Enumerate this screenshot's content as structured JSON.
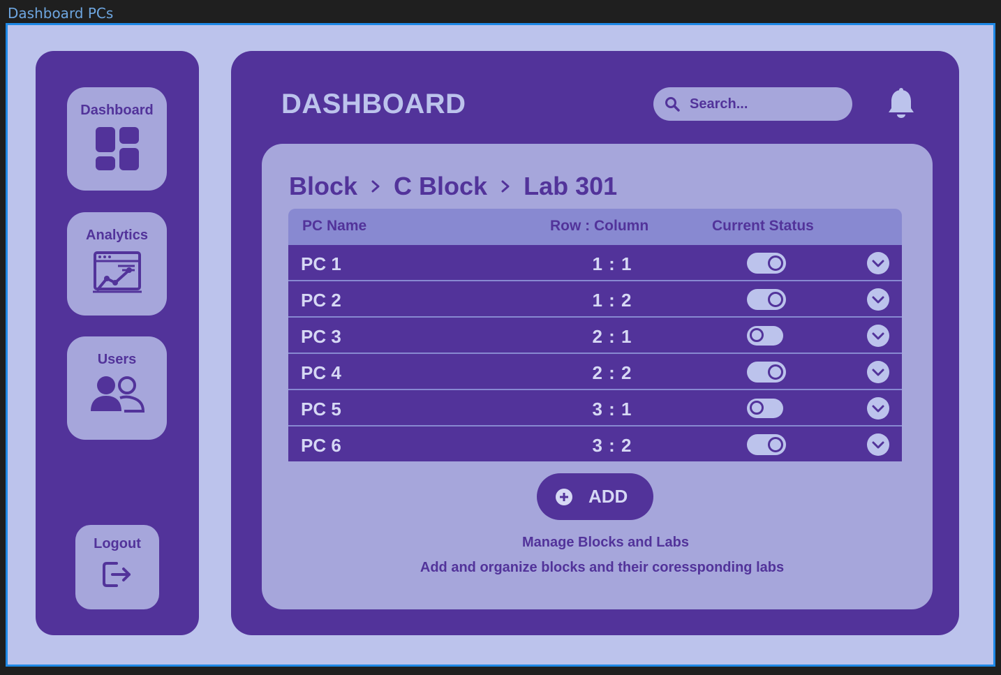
{
  "frame_title": "Dashboard PCs",
  "sidebar": {
    "items": [
      {
        "label": "Dashboard",
        "icon": "grid-icon"
      },
      {
        "label": "Analytics",
        "icon": "analytics-chart-icon"
      },
      {
        "label": "Users",
        "icon": "users-icon"
      }
    ],
    "logout": {
      "label": "Logout",
      "icon": "logout-icon"
    }
  },
  "header": {
    "title": "DASHBOARD",
    "search_placeholder": "Search...",
    "notification_icon": "bell-icon"
  },
  "breadcrumb": [
    "Block",
    "C Block",
    "Lab 301"
  ],
  "table": {
    "columns": [
      "PC Name",
      "Row : Column",
      "Current Status"
    ],
    "rows": [
      {
        "name": "PC 1",
        "position": "1 : 1",
        "status_on": true
      },
      {
        "name": "PC 2",
        "position": "1 : 2",
        "status_on": true
      },
      {
        "name": "PC 3",
        "position": "2 : 1",
        "status_on": false
      },
      {
        "name": "PC 4",
        "position": "2 : 2",
        "status_on": true
      },
      {
        "name": "PC 5",
        "position": "3 : 1",
        "status_on": false
      },
      {
        "name": "PC 6",
        "position": "3 : 2",
        "status_on": true
      }
    ]
  },
  "add_button": {
    "label": "ADD",
    "icon": "plus-circle-icon"
  },
  "captions": {
    "title": "Manage Blocks and Labs",
    "subtitle": "Add and organize blocks and their coressponding labs"
  },
  "colors": {
    "primary": "#52339a",
    "panel": "#a6a6db",
    "background": "#bcc3ec",
    "table_header": "#8889d1"
  }
}
